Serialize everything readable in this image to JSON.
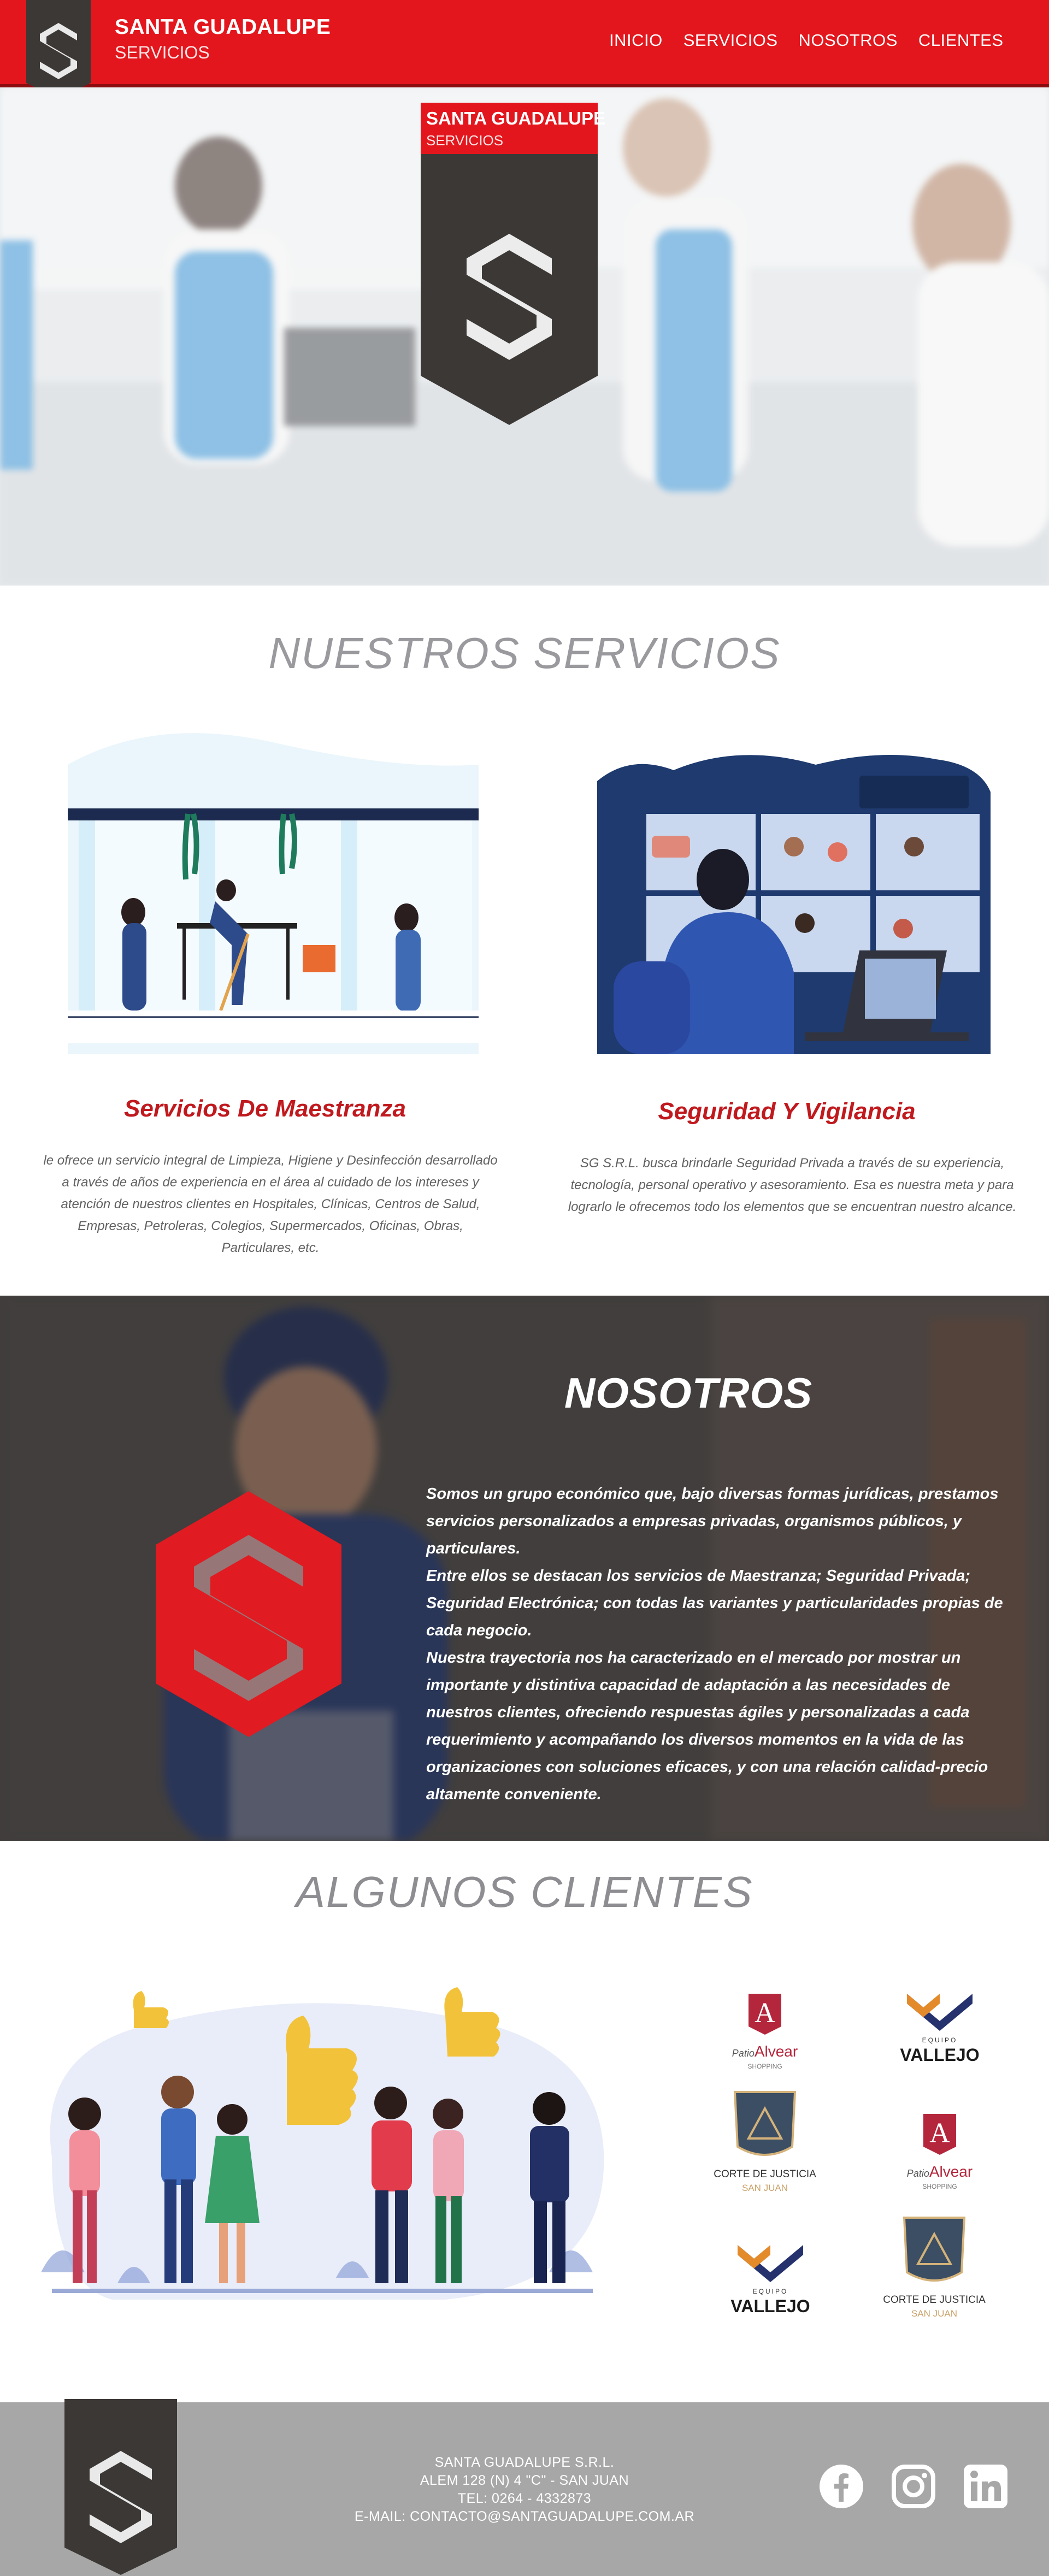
{
  "brand": {
    "name": "SANTA GUADALUPE",
    "sub": "SERVICIOS",
    "red": "#e3161d",
    "dark": "#3c3836"
  },
  "nav": {
    "items": [
      "INICIO",
      "SERVICIOS",
      "NOSOTROS",
      "CLIENTES"
    ]
  },
  "hero": {
    "card_title": "SANTA GUADALUPE",
    "card_sub": "SERVICIOS"
  },
  "services": {
    "title": "NUESTROS SERVICIOS",
    "items": [
      {
        "title": "Servicios De Maestranza",
        "text": "le ofrece un servicio integral de Limpieza, Higiene y Desinfección desarrollado a través de años de experiencia en el área al cuidado de los intereses y atención de nuestros clientes en Hospitales, Clínicas, Centros de Salud, Empresas, Petroleras, Colegios, Supermercados, Oficinas, Obras, Particulares, etc."
      },
      {
        "title": "Seguridad Y Vigilancia",
        "text": "SG S.R.L. busca brindarle Seguridad Privada a través de su experiencia, tecnología, personal operativo y asesoramiento. Esa es nuestra meta y para lograrlo le ofrecemos todo los elementos que se encuentran nuestro alcance."
      }
    ]
  },
  "about": {
    "title": "NOSOTROS",
    "paragraphs": [
      "Somos un grupo económico que, bajo diversas formas jurídicas, prestamos servicios personalizados a empresas privadas, organismos públicos, y particulares.",
      "Entre ellos se destacan los servicios de Maestranza; Seguridad Privada; Seguridad Electrónica; con todas las variantes y particularidades propias de cada negocio.",
      "Nuestra trayectoria nos ha caracterizado en el mercado por mostrar un importante y distintiva capacidad de adaptación a las necesidades de nuestros clientes, ofreciendo respuestas ágiles y personalizadas a cada requerimiento y acompañando los diversos momentos en la vida de las organizaciones con soluciones eficaces, y con una relación calidad-precio altamente conveniente."
    ]
  },
  "clients": {
    "title": "ALGUNOS CLIENTES",
    "logos": [
      {
        "name": "Patio Alvear",
        "top": "Patio",
        "main": "Alvear",
        "sub": "SHOPPING"
      },
      {
        "name": "Equipo Vallejo",
        "top": "EQUIPO",
        "main": "VALLEJO"
      },
      {
        "name": "Corte de Justicia",
        "top": "CORTE DE JUSTICIA",
        "main": "SAN JUAN"
      },
      {
        "name": "Patio Alvear",
        "top": "Patio",
        "main": "Alvear",
        "sub": "SHOPPING"
      },
      {
        "name": "Equipo Vallejo",
        "top": "EQUIPO",
        "main": "VALLEJO"
      },
      {
        "name": "Corte de Justicia",
        "top": "CORTE DE JUSTICIA",
        "main": "SAN JUAN"
      }
    ]
  },
  "footer": {
    "company": "SANTA GUADALUPE S.R.L.",
    "address": "ALEM 128 (N) 4 \"C\" - SAN JUAN",
    "phone": "TEL: 0264 - 4332873",
    "email": "E-MAIL: CONTACTO@SANTAGUADALUPE.COM.AR",
    "social": [
      "facebook-icon",
      "instagram-icon",
      "linkedin-icon"
    ]
  }
}
